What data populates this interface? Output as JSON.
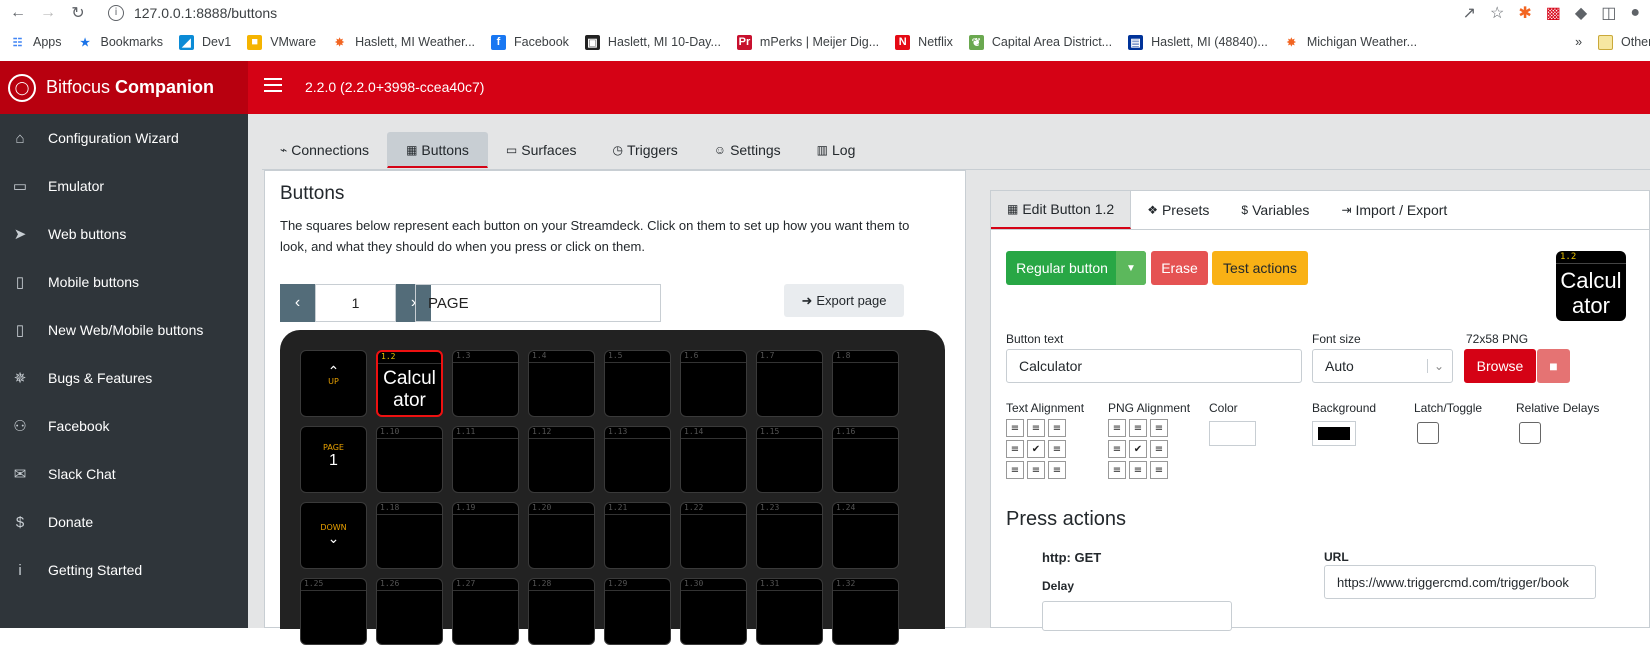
{
  "browser": {
    "url": "127.0.0.1:8888/buttons",
    "bookmarks": [
      {
        "label": "Apps",
        "icon": "apps-icon",
        "color": "#4285f4"
      },
      {
        "label": "Bookmarks",
        "icon": "star-icon",
        "color": "#1a73e8"
      },
      {
        "label": "Dev1",
        "icon": "sail-icon",
        "color": "#0b8bd6"
      },
      {
        "label": "VMware",
        "icon": "vmware-icon",
        "color": "#f5b400"
      },
      {
        "label": "Haslett, MI Weather...",
        "icon": "weather-icon",
        "color": "#f26522"
      },
      {
        "label": "Facebook",
        "icon": "facebook-icon",
        "color": "#1877f2"
      },
      {
        "label": "Haslett, MI 10-Day...",
        "icon": "wunderground-icon",
        "color": "#222222"
      },
      {
        "label": "mPerks | Meijer Dig...",
        "icon": "meijer-icon",
        "color": "#c8102e"
      },
      {
        "label": "Netflix",
        "icon": "netflix-icon",
        "color": "#e50914"
      },
      {
        "label": "Capital Area District...",
        "icon": "cadl-icon",
        "color": "#6aa84f"
      },
      {
        "label": "Haslett, MI (48840)...",
        "icon": "news-icon",
        "color": "#003399"
      },
      {
        "label": "Michigan Weather...",
        "icon": "weather-icon",
        "color": "#f26522"
      }
    ],
    "other_bookmarks": "Other boo"
  },
  "header": {
    "brand_light": "Bitfocus",
    "brand_bold": "Companion",
    "version": "2.2.0 (2.2.0+3998-ccea40c7)"
  },
  "sidebar": {
    "items": [
      {
        "label": "Configuration Wizard",
        "icon": "wizard-icon"
      },
      {
        "label": "Emulator",
        "icon": "gamepad-icon"
      },
      {
        "label": "Web buttons",
        "icon": "pointer-icon"
      },
      {
        "label": "Mobile buttons",
        "icon": "tablet-icon"
      },
      {
        "label": "New Web/Mobile buttons",
        "icon": "tablet-icon"
      },
      {
        "label": "Bugs & Features",
        "icon": "bug-icon"
      },
      {
        "label": "Facebook",
        "icon": "users-icon"
      },
      {
        "label": "Slack Chat",
        "icon": "comments-icon"
      },
      {
        "label": "Donate",
        "icon": "dollar-icon"
      },
      {
        "label": "Getting Started",
        "icon": "info-icon"
      }
    ]
  },
  "tabs": [
    {
      "label": "Connections",
      "icon": "plug-icon"
    },
    {
      "label": "Buttons",
      "icon": "calculator-icon"
    },
    {
      "label": "Surfaces",
      "icon": "gamepad-icon"
    },
    {
      "label": "Triggers",
      "icon": "clock-icon"
    },
    {
      "label": "Settings",
      "icon": "user-cog-icon"
    },
    {
      "label": "Log",
      "icon": "clipboard-icon"
    }
  ],
  "buttons_panel": {
    "title": "Buttons",
    "description": "The squares below represent each button on your Streamdeck. Click on them to set up how you want them to look, and what they should do when you press or click on them.",
    "page_number": "1",
    "page_name": "PAGE",
    "export_label": "Export page",
    "nav_up": "UP",
    "nav_page": "PAGE",
    "nav_page_num": "1",
    "nav_down": "DOWN",
    "selected_key_text": "Calcul ator",
    "key_ids": [
      [
        "1.2",
        "1.3",
        "1.4",
        "1.5",
        "1.6",
        "1.7",
        "1.8"
      ],
      [
        "1.10",
        "1.11",
        "1.12",
        "1.13",
        "1.14",
        "1.15",
        "1.16"
      ],
      [
        "1.18",
        "1.19",
        "1.20",
        "1.21",
        "1.22",
        "1.23",
        "1.24"
      ],
      [
        "1.25",
        "1.26",
        "1.27",
        "1.28",
        "1.29",
        "1.30",
        "1.31",
        "1.32"
      ]
    ]
  },
  "edit_panel": {
    "tabs": [
      {
        "label": "Edit Button 1.2",
        "icon": "calculator-icon"
      },
      {
        "label": "Presets",
        "icon": "gift-icon"
      },
      {
        "label": "Variables",
        "icon": "dollar-icon"
      },
      {
        "label": "Import / Export",
        "icon": "import-icon"
      }
    ],
    "regular_button": "Regular button",
    "erase": "Erase",
    "test_actions": "Test actions",
    "preview_id": "1.2",
    "preview_text": "Calcul ator",
    "button_text_label": "Button text",
    "button_text_value": "Calculator",
    "font_size_label": "Font size",
    "font_size_value": "Auto",
    "png_label": "72x58 PNG",
    "browse": "Browse",
    "text_align_label": "Text Alignment",
    "png_align_label": "PNG Alignment",
    "color_label": "Color",
    "background_label": "Background",
    "latch_label": "Latch/Toggle",
    "relative_delays_label": "Relative Delays",
    "press_actions_title": "Press actions",
    "action_name": "http: GET",
    "delay_label": "Delay",
    "url_label": "URL",
    "url_value": "https://www.triggercmd.com/trigger/book"
  },
  "colors": {
    "brand_red": "#d50215",
    "success": "#28a745",
    "danger": "#e55353",
    "warning": "#f9b115",
    "sidebar_bg": "#2f353a"
  }
}
